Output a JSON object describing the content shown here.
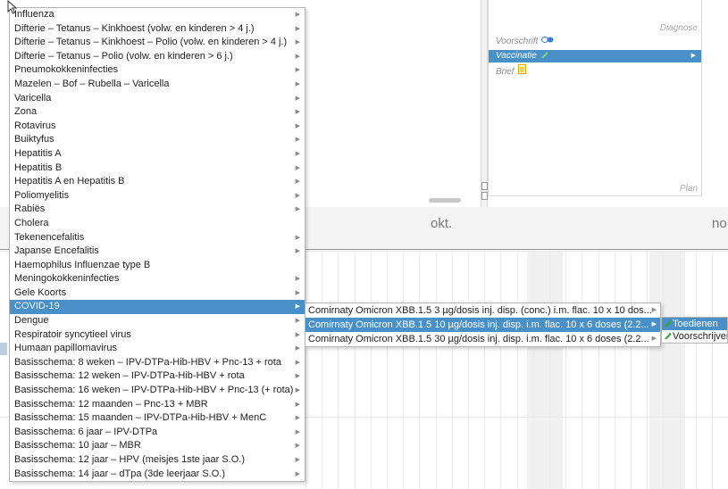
{
  "right_panel": {
    "diagnose_label": "Diagnose",
    "plan_label": "Plan",
    "items": [
      {
        "label": "Voorschrift",
        "selected": false,
        "icon": "pills-icon"
      },
      {
        "label": "Vaccinatie",
        "selected": true,
        "icon": "syringe-icon"
      },
      {
        "label": "Brief",
        "selected": false,
        "icon": "document-icon"
      }
    ]
  },
  "timeline": {
    "months": [
      "okt.",
      "no"
    ]
  },
  "menu": {
    "items": [
      {
        "label": "Influenza",
        "submenu": true
      },
      {
        "label": "Difterie – Tetanus – Kinkhoest (volw. en kinderen > 4 j.)",
        "submenu": true
      },
      {
        "label": "Difterie – Tetanus – Kinkhoest – Polio (volw. en kinderen > 4 j.)",
        "submenu": true
      },
      {
        "label": "Difterie – Tetanus – Polio (volw. en kinderen > 6 j.)",
        "submenu": true
      },
      {
        "label": "Pneumokokkeninfecties",
        "submenu": true
      },
      {
        "label": "Mazelen – Bof – Rubella – Varicella",
        "submenu": true
      },
      {
        "label": "Varicella",
        "submenu": true
      },
      {
        "label": "Zona",
        "submenu": true
      },
      {
        "label": "Rotavirus",
        "submenu": true
      },
      {
        "label": "Buiktyfus",
        "submenu": true
      },
      {
        "label": "Hepatitis A",
        "submenu": true
      },
      {
        "label": "Hepatitis B",
        "submenu": true
      },
      {
        "label": "Hepatitis A en Hepatitis B",
        "submenu": true
      },
      {
        "label": "Poliomyelitis",
        "submenu": true
      },
      {
        "label": "Rabiës",
        "submenu": true
      },
      {
        "label": "Cholera",
        "submenu": false
      },
      {
        "label": "Tekenencefalitis",
        "submenu": true
      },
      {
        "label": "Japanse Encefalitis",
        "submenu": true
      },
      {
        "label": "Haemophilus Influenzae type B",
        "submenu": false
      },
      {
        "label": "Meningokokkeninfecties",
        "submenu": true
      },
      {
        "label": "Gele Koorts",
        "submenu": true
      },
      {
        "label": "COVID-19",
        "submenu": true,
        "selected": true
      },
      {
        "label": "Dengue",
        "submenu": true
      },
      {
        "label": "Respiratoir syncytieel virus",
        "submenu": true
      },
      {
        "label": "Humaan papillomavirus",
        "submenu": true
      },
      {
        "label": "Basisschema: 8 weken – IPV-DTPa-Hib-HBV + Pnc-13 + rota",
        "submenu": true
      },
      {
        "label": "Basisschema: 12 weken – IPV-DTPa-Hib-HBV + rota",
        "submenu": true
      },
      {
        "label": "Basisschema: 16 weken – IPV-DTPa-Hib-HBV + Pnc-13 (+ rota)",
        "submenu": true
      },
      {
        "label": "Basisschema: 12 maanden – Pnc-13 + MBR",
        "submenu": true
      },
      {
        "label": "Basisschema: 15 maanden – IPV-DTPa-Hib-HBV + MenC",
        "submenu": true
      },
      {
        "label": "Basisschema: 6 jaar – IPV-DTPa",
        "submenu": true
      },
      {
        "label": "Basisschema: 10 jaar – MBR",
        "submenu": true
      },
      {
        "label": "Basisschema: 12 jaar – HPV (meisjes 1ste jaar S.O.)",
        "submenu": true
      },
      {
        "label": "Basisschema: 14 jaar – dTpa (3de leerjaar S.O.)",
        "submenu": true
      }
    ]
  },
  "covid_submenu": {
    "items": [
      {
        "label": "Comirnaty Omicron XBB.1.5 3 µg/dosis inj. disp. (conc.) i.m. flac. 10 x 10 dos...",
        "selected": false
      },
      {
        "label": "Comirnaty Omicron XBB.1.5 10 µg/dosis inj. disp. i.m. flac. 10 x 6 doses (2.2...",
        "selected": true
      },
      {
        "label": "Comirnaty Omicron XBB.1.5 30 µg/dosis inj. disp. i.m. flac. 10 x 6 doses (2.2...",
        "selected": false
      }
    ]
  },
  "action_submenu": {
    "items": [
      {
        "label": "Toedienen",
        "selected": true,
        "icon": "syringe-icon"
      },
      {
        "label": "Voorschrijven",
        "selected": false,
        "icon": "syringe-icon"
      }
    ]
  },
  "colors": {
    "selection": "#4a90c8",
    "syringe_green": "#3aa33a"
  }
}
